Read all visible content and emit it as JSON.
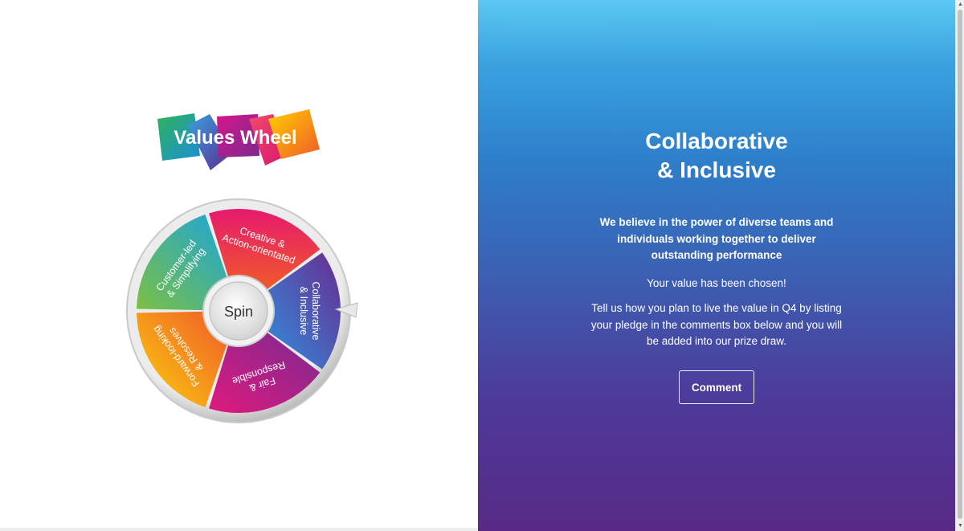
{
  "logo": {
    "text": "Values Wheel"
  },
  "wheel": {
    "spin_label": "Spin",
    "segments": [
      {
        "line1": "Creative &",
        "line2": "Action-orientated",
        "color_start": "#e6196e",
        "color_end": "#f05a2a"
      },
      {
        "line1": "Collaborative",
        "line2": "& Inclusive",
        "color_start": "#6a2c91",
        "color_end": "#2f8fdc"
      },
      {
        "line1": "Fair &",
        "line2": "Responsible",
        "color_start": "#e0197d",
        "color_end": "#7a2a92"
      },
      {
        "line1": "Forward-looking",
        "line2": "& Resolves",
        "color_start": "#fbd10c",
        "color_end": "#f05a2a"
      },
      {
        "line1": "Customer-led",
        "line2": "& Simplifying",
        "color_start": "#7cc043",
        "color_end": "#1ea5d8"
      }
    ],
    "pointer_icon": "triangle-pointer"
  },
  "panel": {
    "title_line1": "Collaborative",
    "title_line2": "& Inclusive",
    "description": "We believe in the power of diverse teams and individuals working together to deliver outstanding performance",
    "chosen": "Your value has been chosen!",
    "pledge": "Tell us how you plan to live the value in Q4 by listing your pledge in the comments box below and you will be added into our prize draw.",
    "comment_button": "Comment"
  }
}
